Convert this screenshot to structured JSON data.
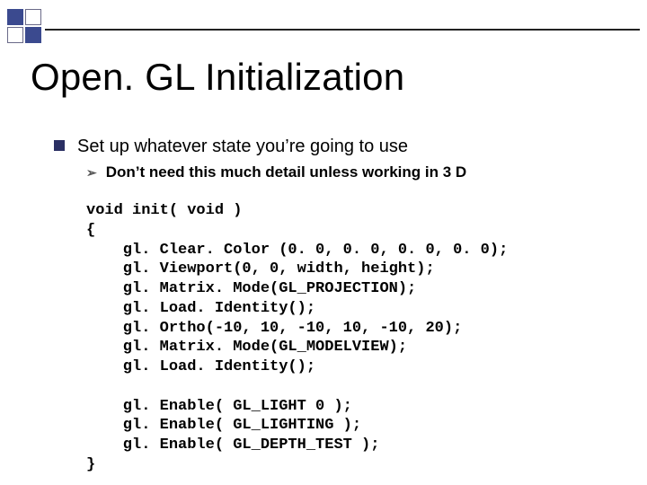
{
  "title": "Open. GL Initialization",
  "bullet_l1": "Set up whatever state you’re going to use",
  "bullet_l2": "Don’t need this much detail unless working in 3 D",
  "code": "void init( void )\n{\n    gl. Clear. Color (0. 0, 0. 0, 0. 0, 0. 0);\n    gl. Viewport(0, 0, width, height);\n    gl. Matrix. Mode(GL_PROJECTION);\n    gl. Load. Identity();\n    gl. Ortho(-10, 10, -10, 10, -10, 20);\n    gl. Matrix. Mode(GL_MODELVIEW);\n    gl. Load. Identity();\n\n    gl. Enable( GL_LIGHT 0 );\n    gl. Enable( GL_LIGHTING );\n    gl. Enable( GL_DEPTH_TEST );\n}"
}
